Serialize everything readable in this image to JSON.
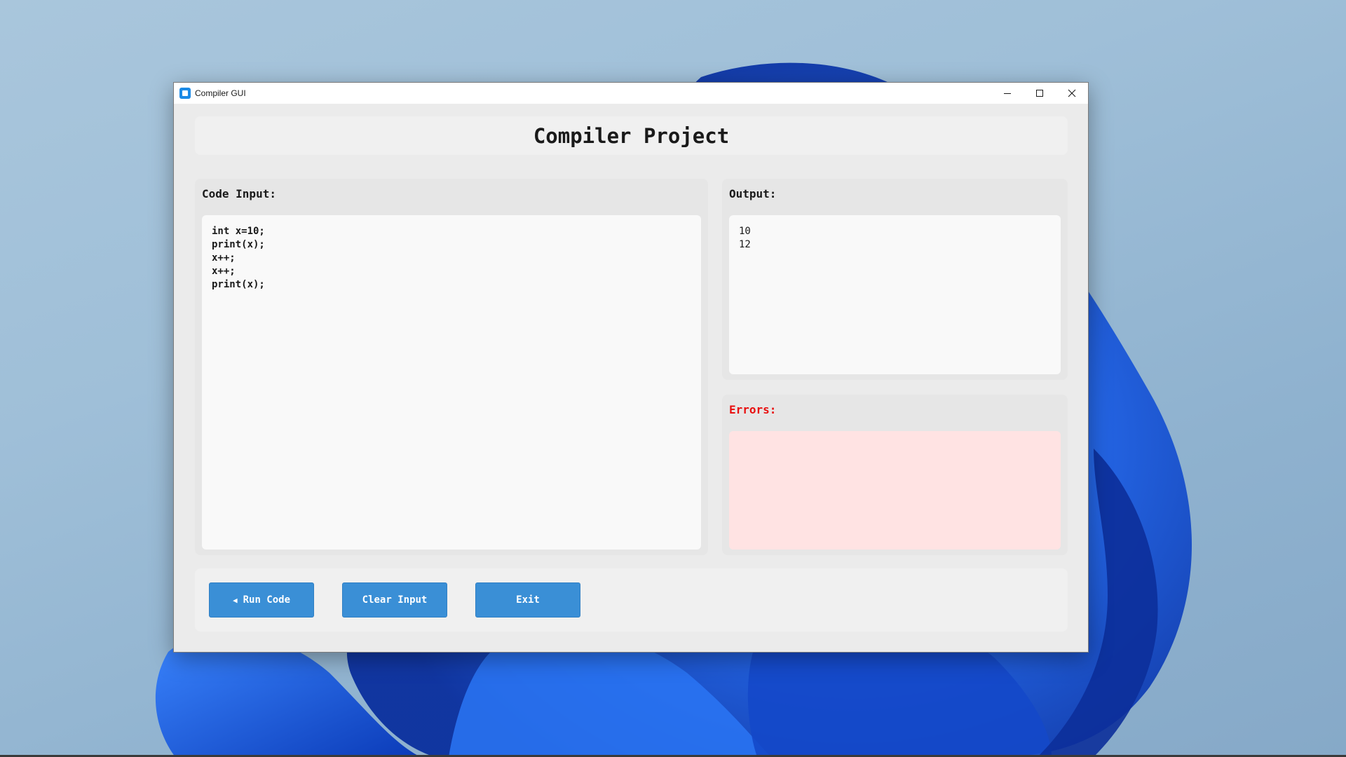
{
  "window": {
    "title": "Compiler GUI"
  },
  "header": {
    "title": "Compiler Project"
  },
  "code_panel": {
    "label": "Code Input:",
    "value": "int x=10;\nprint(x);\nx++;\nx++;\nprint(x);"
  },
  "output_panel": {
    "label": "Output:",
    "value": "10\n12"
  },
  "errors_panel": {
    "label": "Errors:",
    "value": ""
  },
  "buttons": {
    "run_icon": "◀",
    "run_label": "Run Code",
    "clear_label": "Clear Input",
    "exit_label": "Exit"
  },
  "colors": {
    "button_bg": "#3a8fd6",
    "error_label": "#e81010",
    "error_bg": "#ffe3e3",
    "wallpaper_blue": "#1e5fe0"
  },
  "icons": {
    "app": "app-icon",
    "minimize": "minimize-icon",
    "maximize": "maximize-icon",
    "close": "close-icon",
    "run": "play-icon"
  }
}
